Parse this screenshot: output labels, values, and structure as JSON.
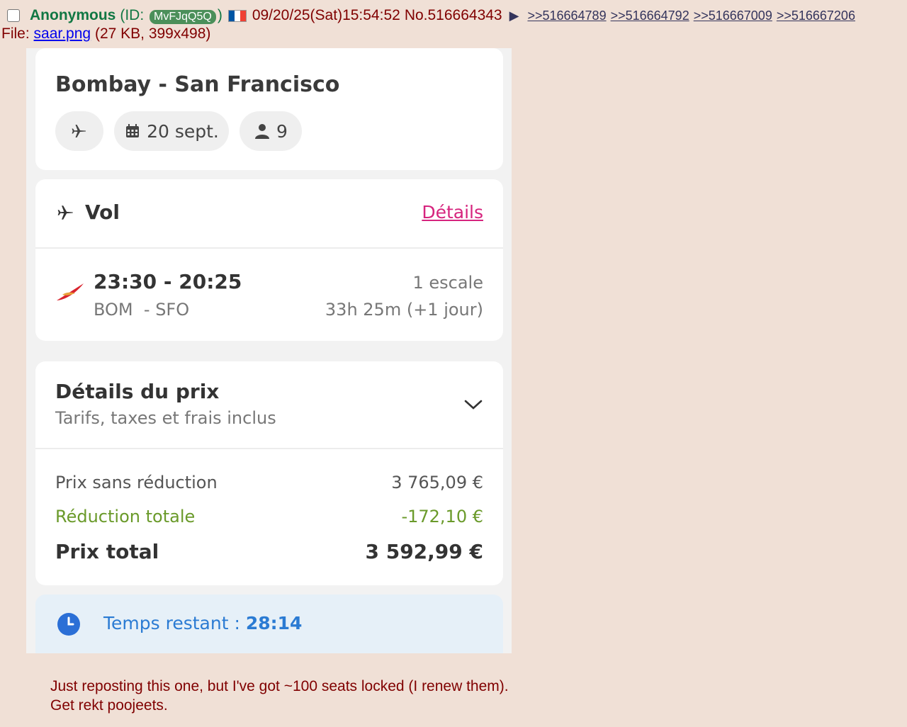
{
  "post": {
    "name": "Anonymous",
    "id_prefix": "(ID:",
    "id": "MvFJqQ5Q",
    "id_suffix": ")",
    "flag_colors": [
      "#0055a4",
      "#ffffff",
      "#ef4135"
    ],
    "datetime": "09/20/25(Sat)15:54:52",
    "post_number": "No.516664343",
    "arrow": "▶",
    "backlinks": [
      ">>516664789",
      ">>516664792",
      ">>516667009",
      ">>516667206"
    ],
    "file_prefix": "File:",
    "file_name": "saar.png",
    "file_meta": "(27 KB, 399x498)",
    "comment_lines": [
      "Just reposting this one, but I've got ~100 seats locked (I renew them).",
      "Get rekt poojeets."
    ]
  },
  "booking": {
    "route": "Bombay - San Francisco",
    "date_chip": "20 sept.",
    "passengers_chip": "9",
    "icons": [
      "plane-icon",
      "calendar-icon",
      "person-icon",
      "airline-logo-icon",
      "chevron-down-icon",
      "clock-icon"
    ],
    "flight_section_label": "Vol",
    "details_link": "Détails",
    "times": "23:30 - 20:25",
    "airports": "BOM  - SFO",
    "stops": "1 escale",
    "duration": "33h 25m (+1 jour)",
    "price_title": "Détails du prix",
    "price_subtitle": "Tarifs, taxes et frais inclus",
    "price_rows": [
      {
        "label": "Prix sans réduction",
        "value": "3 765,09 €"
      },
      {
        "label": "Réduction totale",
        "value": "-172,10 €"
      },
      {
        "label": "Prix total",
        "value": "3 592,99 €"
      }
    ],
    "timer_label": "Temps restant : ",
    "timer_value": "28:14",
    "accent_pink": "#d6247e",
    "accent_green": "#6a9a2a",
    "accent_blue": "#2b7bd3"
  }
}
